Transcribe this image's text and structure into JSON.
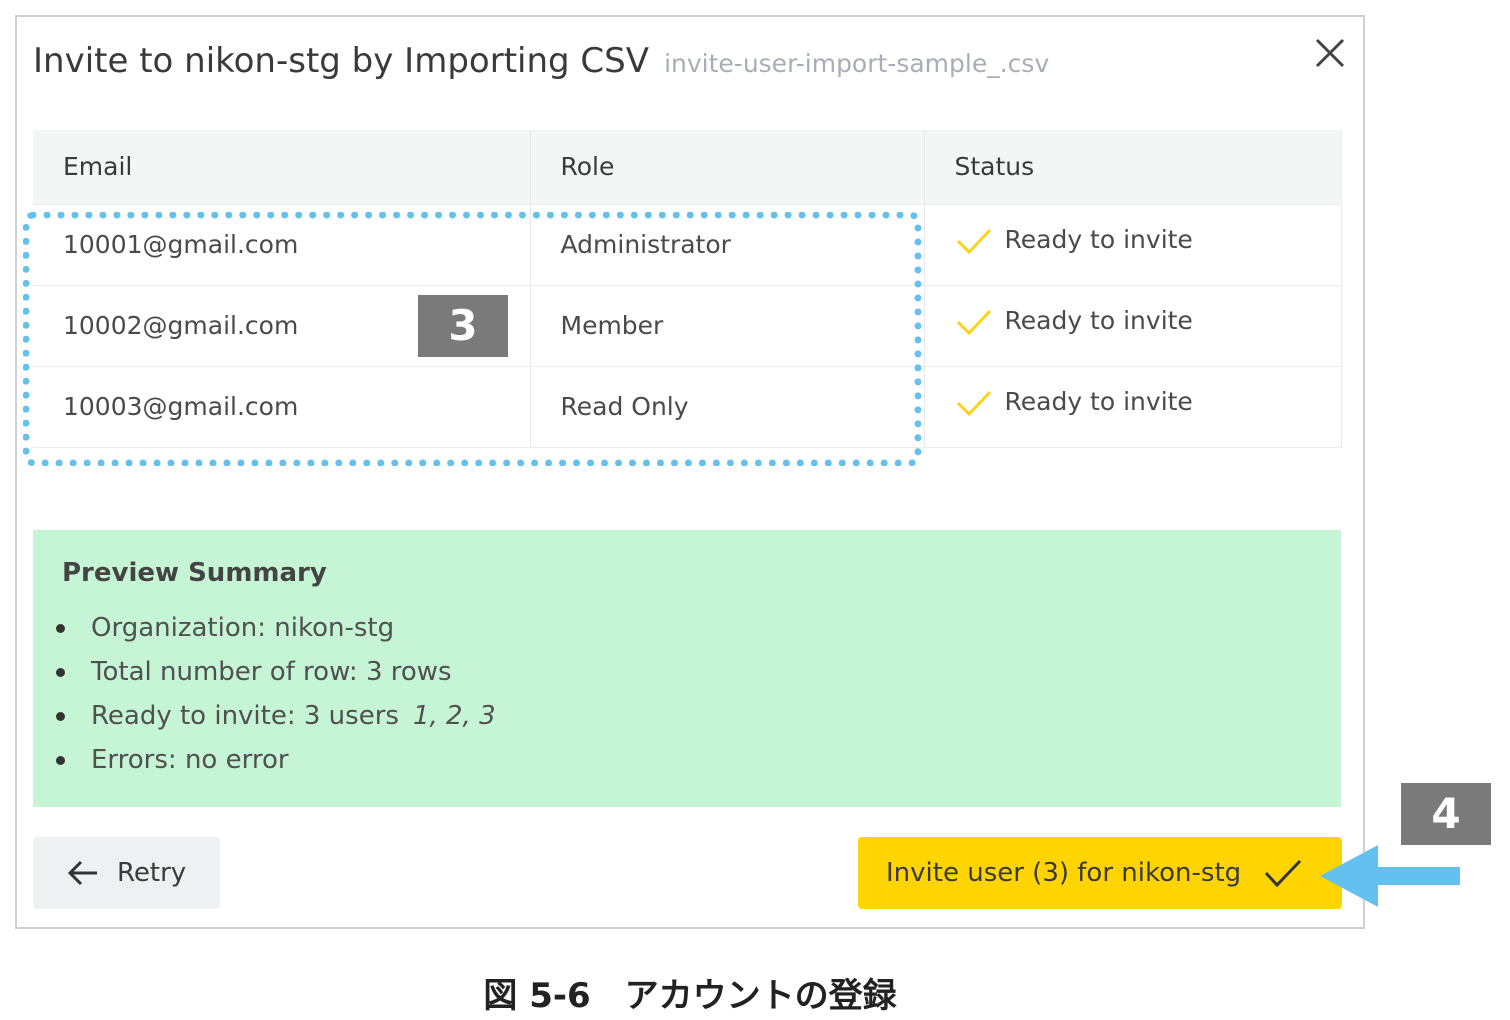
{
  "dialog": {
    "title": "Invite to nikon-stg by Importing CSV",
    "filename": "invite-user-import-sample_.csv"
  },
  "table": {
    "columns": [
      "Email",
      "Role",
      "Status"
    ],
    "rows": [
      {
        "email": "10001@gmail.com",
        "role": "Administrator",
        "status": "Ready to invite"
      },
      {
        "email": "10002@gmail.com",
        "role": "Member",
        "status": "Ready to invite"
      },
      {
        "email": "10003@gmail.com",
        "role": "Read Only",
        "status": "Ready to invite"
      }
    ]
  },
  "summary": {
    "title": "Preview Summary",
    "organization": "Organization: nikon-stg",
    "total_rows": "Total number of row: 3 rows",
    "ready": "Ready to invite: 3 users",
    "ready_ids": "1, 2, 3",
    "errors": "Errors: no error"
  },
  "buttons": {
    "retry": "Retry",
    "invite": "Invite user (3) for nikon-stg"
  },
  "annotations": {
    "badge_3": "3",
    "badge_4": "4"
  },
  "caption": "図 5-6　アカウントの登録",
  "icons": {
    "close": "close-icon",
    "status": "check-icon",
    "retry": "arrow-left-icon",
    "invite": "check-icon"
  },
  "colors": {
    "status": "#ffd21a",
    "invite_button": "#ffd400",
    "summary_bg": "#c5f5d5",
    "highlight": "#64c0ee",
    "badge": "#7a7a7a"
  }
}
